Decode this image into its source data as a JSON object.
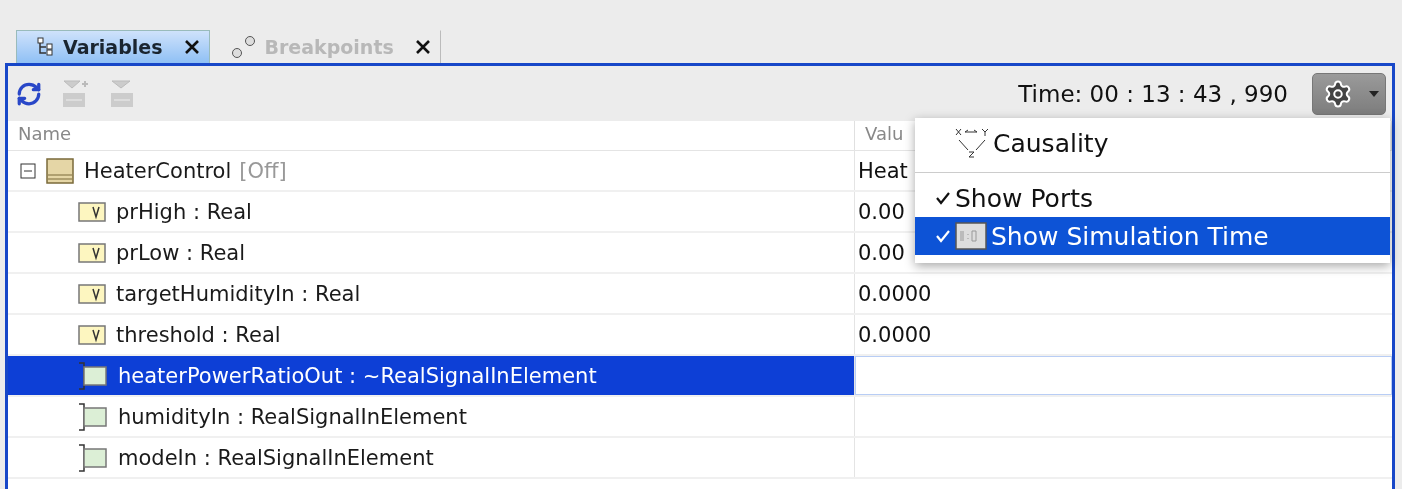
{
  "tabs": [
    {
      "label": "Variables",
      "selected": true,
      "kind": "tree"
    },
    {
      "label": "Breakpoints",
      "selected": false,
      "kind": "breakpoints"
    }
  ],
  "toolbar": {
    "time": "Time: 00 : 13 : 43 , 990"
  },
  "table": {
    "columns": [
      "Name",
      "Valu"
    ],
    "rows": [
      {
        "name": "HeaterControl",
        "suffix": "[Off]",
        "kind": "block",
        "value": "Heat",
        "selected": false,
        "expanded": true,
        "children": [
          {
            "name": "prHigh : Real",
            "kind": "variable",
            "value": "0.00",
            "selected": false
          },
          {
            "name": "prLow : Real",
            "kind": "variable",
            "value": "0.00",
            "selected": false
          },
          {
            "name": "targetHumidityIn : Real",
            "kind": "variable",
            "value": "0.0000",
            "selected": false
          },
          {
            "name": "threshold : Real",
            "kind": "variable",
            "value": "0.0000",
            "selected": false
          },
          {
            "name": "heaterPowerRatioOut : ~RealSignalInElement",
            "kind": "port",
            "selected": true
          },
          {
            "name": "humidityIn : RealSignalInElement",
            "kind": "port",
            "selected": false
          },
          {
            "name": "modeIn : RealSignalInElement",
            "kind": "port",
            "selected": false
          }
        ]
      }
    ]
  },
  "menu": {
    "items": [
      {
        "label": "Causality",
        "kind": "causality",
        "checked": false,
        "selected": false
      },
      {
        "label": "Show Ports",
        "kind": "plain",
        "checked": true,
        "selected": false
      },
      {
        "label": "Show Simulation Time",
        "kind": "time",
        "checked": true,
        "selected": true
      }
    ]
  }
}
